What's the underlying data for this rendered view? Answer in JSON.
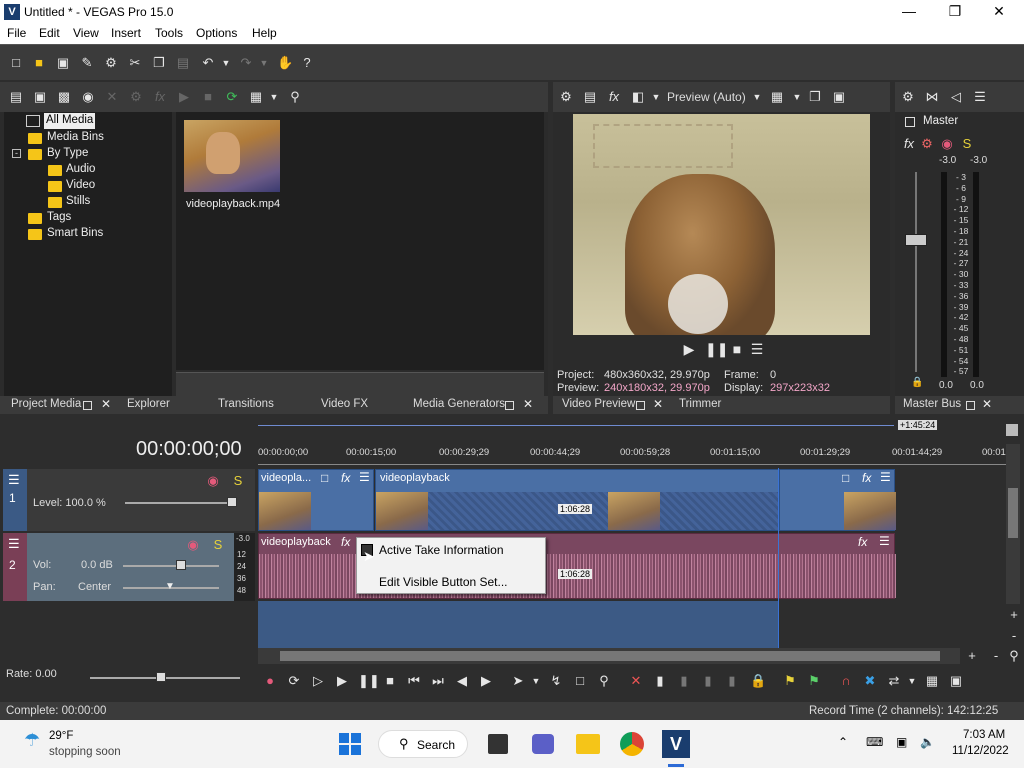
{
  "window": {
    "title": "Untitled * - VEGAS Pro 15.0",
    "app_icon": "V"
  },
  "menu": [
    "File",
    "Edit",
    "View",
    "Insert",
    "Tools",
    "Options",
    "Help"
  ],
  "media_tree": {
    "items": [
      {
        "label": "All Media"
      },
      {
        "label": "Media Bins"
      },
      {
        "label": "By Type"
      },
      {
        "label": "Audio"
      },
      {
        "label": "Video"
      },
      {
        "label": "Stills"
      },
      {
        "label": "Tags"
      },
      {
        "label": "Smart Bins"
      }
    ]
  },
  "media_file": {
    "name": "videoplayback.mp4"
  },
  "left_tabs": {
    "project_media": "Project Media",
    "explorer": "Explorer",
    "transitions": "Transitions",
    "video_fx": "Video FX",
    "media_generators": "Media Generators"
  },
  "preview": {
    "quality": "Preview (Auto)",
    "project_label": "Project:",
    "project_value": "480x360x32, 29.970p",
    "preview_label": "Preview:",
    "preview_value": "240x180x32, 29.970p",
    "frame_label": "Frame:",
    "frame_value": "0",
    "display_label": "Display:",
    "display_value": "297x223x32",
    "tab_video_preview": "Video Preview",
    "tab_trimmer": "Trimmer"
  },
  "master": {
    "title": "Master",
    "left_peak": "-3.0",
    "right_peak": "-3.0",
    "scale": [
      "3",
      "6",
      "9",
      "12",
      "15",
      "18",
      "21",
      "24",
      "27",
      "30",
      "33",
      "36",
      "39",
      "42",
      "45",
      "48",
      "51",
      "54",
      "57"
    ],
    "left_value": "0.0",
    "right_value": "0.0",
    "tab": "Master Bus"
  },
  "timeline": {
    "timecode": "00:00:00;00",
    "region_end": "+1:45:24",
    "ruler": [
      "00:00:00;00",
      "00:00:15;00",
      "00:00:29;29",
      "00:00:44;29",
      "00:00:59;28",
      "00:01:15;00",
      "00:01:29;29",
      "00:01:44;29",
      "00:01"
    ],
    "video_track": {
      "number": "1",
      "level": "Level: 100.0 %",
      "clip1": "videopla...",
      "clip2": "videoplayback",
      "duration": "1:06:28"
    },
    "audio_track": {
      "number": "2",
      "vol_label": "Vol:",
      "vol_value": "0.0 dB",
      "pan_label": "Pan:",
      "pan_value": "Center",
      "meter_top": "-3.0",
      "meter_scale": [
        "12",
        "24",
        "36",
        "48"
      ],
      "clip": "videoplayback",
      "duration": "1:06:28"
    },
    "rate": "Rate: 0.00"
  },
  "context_menu": {
    "item1": "Active Take Information",
    "item2": "Edit Visible Button Set..."
  },
  "status": {
    "left": "Complete: 00:00:00",
    "right": "Record Time (2 channels): 142:12:25"
  },
  "taskbar": {
    "weather_temp": "29°F",
    "weather_text": "stopping soon",
    "search": "Search",
    "time": "7:03 AM",
    "date": "11/12/2022"
  },
  "colors": {
    "accent": "#2d6bd6",
    "video_track": "#4a6fa5",
    "audio_track": "#7a4760",
    "preview_project_text": "#e0e0e0",
    "preview_preview_text": "#f3a6c8"
  }
}
